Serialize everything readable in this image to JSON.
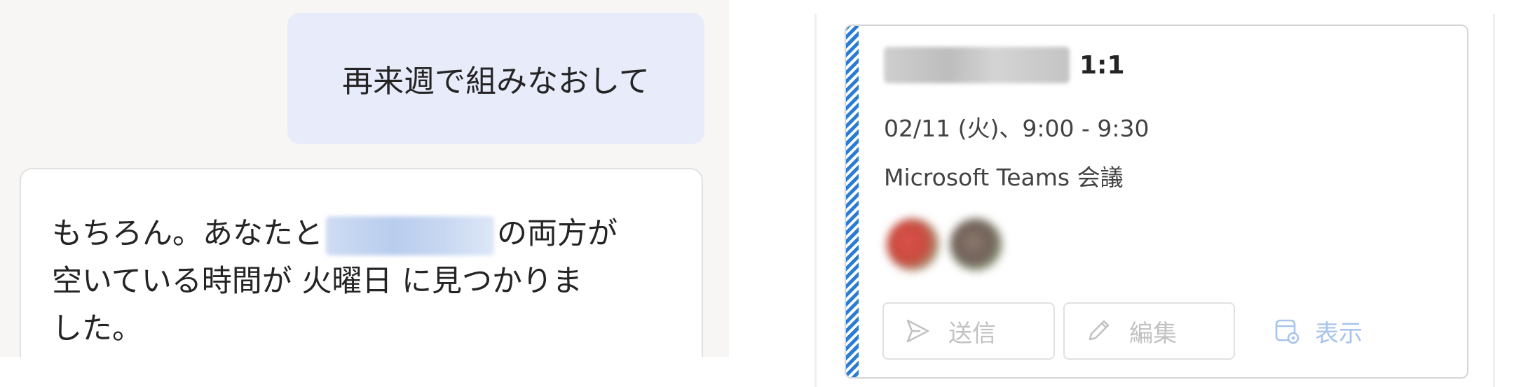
{
  "chat": {
    "user_message": "再来週で組みなおして",
    "bot_message": {
      "before_name": "もちろん。あなたと",
      "after_name": "の両方が",
      "line2": "空いている時間が 火曜日 に見つかりま",
      "line3": "した。"
    }
  },
  "meeting_card": {
    "title_suffix": "1:1",
    "time": "02/11 (火)、9:00 - 9:30",
    "location": "Microsoft Teams 会議",
    "accent_color": "#2b7cd3",
    "actions": {
      "send_label": "送信",
      "edit_label": "編集",
      "view_label": "表示"
    },
    "icons": {
      "send": "send-arrow-icon",
      "edit": "pencil-icon",
      "view": "calendar-view-icon"
    }
  }
}
